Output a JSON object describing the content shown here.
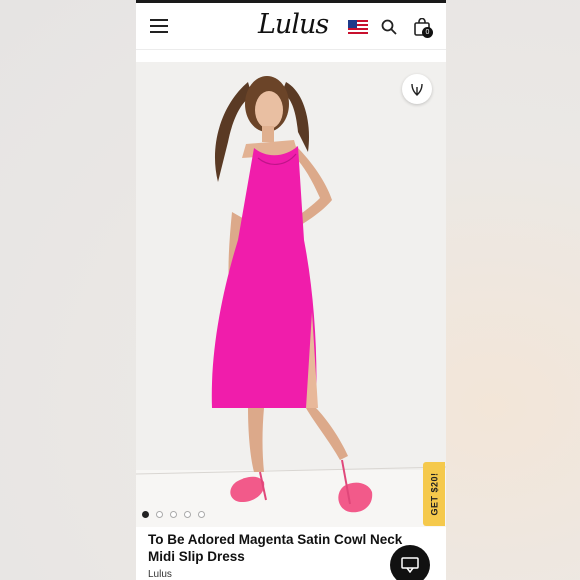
{
  "header": {
    "logo_text": "Lulus",
    "bag_count": "0",
    "icons": [
      "hamburger-menu-icon",
      "us-flag-icon",
      "search-icon",
      "shopping-bag-icon"
    ]
  },
  "product": {
    "title": "To Be Adored Magenta Satin Cowl Neck Midi Slip Dress",
    "brand": "Lulus",
    "dress_color": "#f01dab",
    "image_count": 5,
    "active_image_index": 1
  },
  "promo": {
    "label": "GET $20!",
    "color": "#f5c94c"
  },
  "icons": {
    "favorite": "heart-v-icon",
    "chat": "chat-bubble-icon"
  }
}
